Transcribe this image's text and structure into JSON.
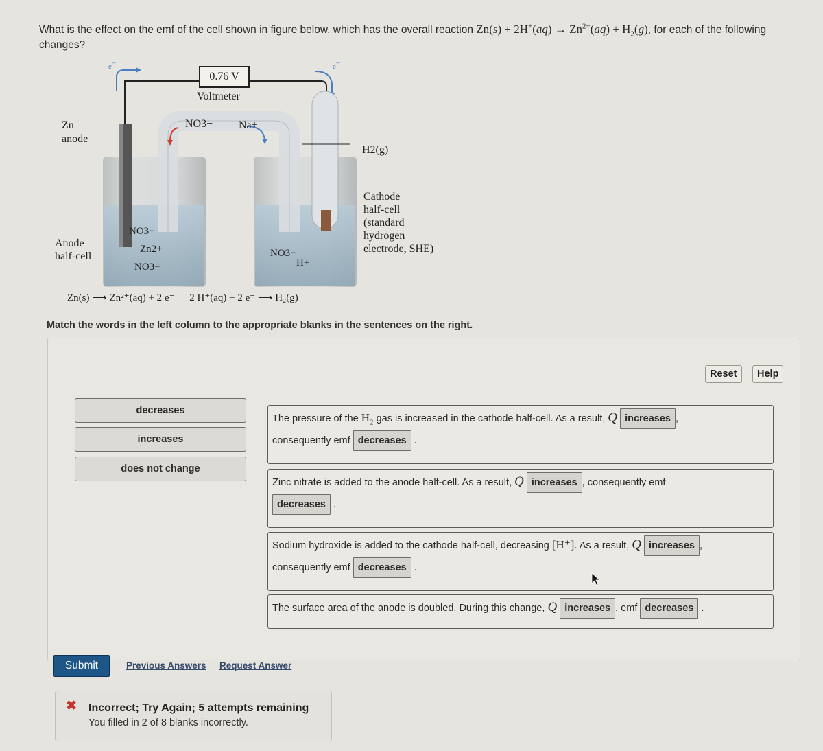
{
  "question": {
    "prefix": "What is the effect on the emf of the cell shown in figure below, which has the overall reaction ",
    "reaction": {
      "reactant1": "Zn",
      "reactant1_state": "s",
      "reactant2": "2H",
      "reactant2_charge": "+",
      "reactant2_state": "aq",
      "arrow": "→",
      "product1": "Zn",
      "product1_charge": "2+",
      "product1_state": "aq",
      "product2": "H",
      "product2_sub": "2",
      "product2_state": "g"
    },
    "suffix": ", for each of the following changes?"
  },
  "figure": {
    "voltmeter_reading": "0.76 V",
    "voltmeter_label": "Voltmeter",
    "electron_label": "e",
    "electron_charge": "−",
    "zn_anode_label_1": "Zn",
    "zn_anode_label_2": "anode",
    "anode_halfcell_1": "Anode",
    "anode_halfcell_2": "half-cell",
    "salt_bridge_anion": "NO3−",
    "salt_bridge_cation": "Na+",
    "h2_label": "H2(g)",
    "cathode_lines": [
      "Cathode",
      "half-cell",
      "(standard",
      "hydrogen",
      "electrode, SHE)"
    ],
    "anode_ions": [
      "NO3−",
      "Zn2+",
      "NO3−"
    ],
    "cathode_ions": [
      "NO3−",
      "H+"
    ],
    "anode_sign": "−",
    "cathode_sign": "+"
  },
  "half_reactions": {
    "anode": "Zn(s) ⟶ Zn²⁺(aq) + 2 e⁻",
    "cathode": "2 H⁺(aq) + 2 e⁻ ⟶ H₂(g)"
  },
  "instruction": "Match the words in the left column to the appropriate blanks in the sentences on the right.",
  "toolbar": {
    "reset_label": "Reset",
    "help_label": "Help"
  },
  "word_bank": [
    "decreases",
    "increases",
    "does not change"
  ],
  "sentences": [
    {
      "part1": "The pressure of the ",
      "species": "H",
      "species_sub": "2",
      "part2": " gas is increased in the cathode half-cell. As a result, ",
      "q": "Q",
      "blank1": "increases",
      "part3": ", ",
      "line2": "consequently emf ",
      "blank2": "decreases",
      "end": "."
    },
    {
      "part1": "Zinc nitrate is added to the anode half-cell. As a result, ",
      "q": "Q",
      "blank1": "increases",
      "part2": ", consequently emf",
      "blank2": "decreases",
      "end": "."
    },
    {
      "part1": "Sodium hydroxide is added to the cathode half-cell, decreasing ",
      "conc": "[H⁺]",
      "part2": ". As a result, ",
      "q": "Q",
      "blank1": "increases",
      "part3": ",",
      "line2": "consequently emf ",
      "blank2": "decreases",
      "end": "."
    },
    {
      "part1": "The surface area of the anode is doubled. During this change, ",
      "q": "Q",
      "blank1": "increases",
      "part2": ", emf ",
      "blank2": "decreases",
      "end": "."
    }
  ],
  "actions": {
    "submit_label": "Submit",
    "previous_answers_label": "Previous Answers",
    "request_answer_label": "Request Answer"
  },
  "feedback": {
    "icon": "✖",
    "title": "Incorrect; Try Again; 5 attempts remaining",
    "detail": "You filled in 2 of 8 blanks incorrectly.",
    "icon_color": "#c8312e"
  },
  "colors": {
    "submit_bg": "#1f5688",
    "link": "#364a6b",
    "electron_arrow": "#4a7fc1",
    "anion_arrow": "#d13a2e"
  }
}
